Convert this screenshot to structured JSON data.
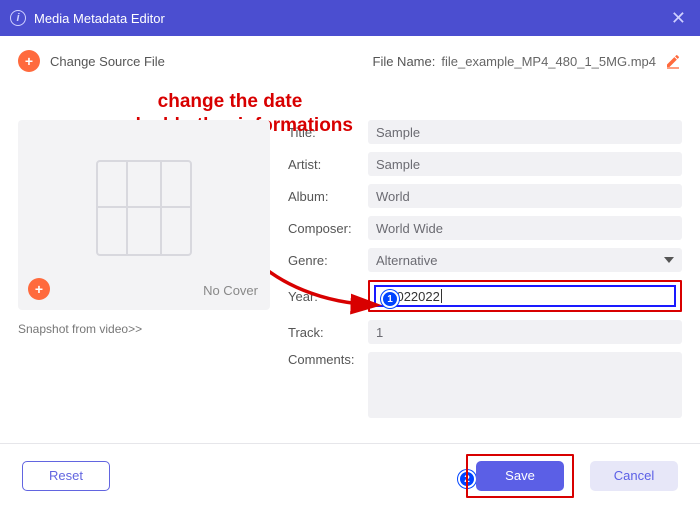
{
  "window": {
    "title": "Media Metadata Editor"
  },
  "toprow": {
    "change_source": "Change Source File",
    "filename_label": "File Name:",
    "filename_value": "file_example_MP4_480_1_5MG.mp4"
  },
  "annotation": {
    "line1": "change the date",
    "line2": "and add other informations",
    "badge1": "1",
    "badge2": "2"
  },
  "cover": {
    "no_cover": "No Cover",
    "snapshot_link": "Snapshot from video>>"
  },
  "fields": {
    "title": {
      "label": "Title:",
      "value": "Sample"
    },
    "artist": {
      "label": "Artist:",
      "value": "Sample"
    },
    "album": {
      "label": "Album:",
      "value": "World"
    },
    "composer": {
      "label": "Composer:",
      "value": "World Wide"
    },
    "genre": {
      "label": "Genre:",
      "value": "Alternative"
    },
    "year": {
      "label": "Year:",
      "value": "03022022"
    },
    "track": {
      "label": "Track:",
      "value": "1"
    },
    "comments": {
      "label": "Comments:",
      "value": ""
    }
  },
  "footer": {
    "reset": "Reset",
    "save": "Save",
    "cancel": "Cancel"
  }
}
